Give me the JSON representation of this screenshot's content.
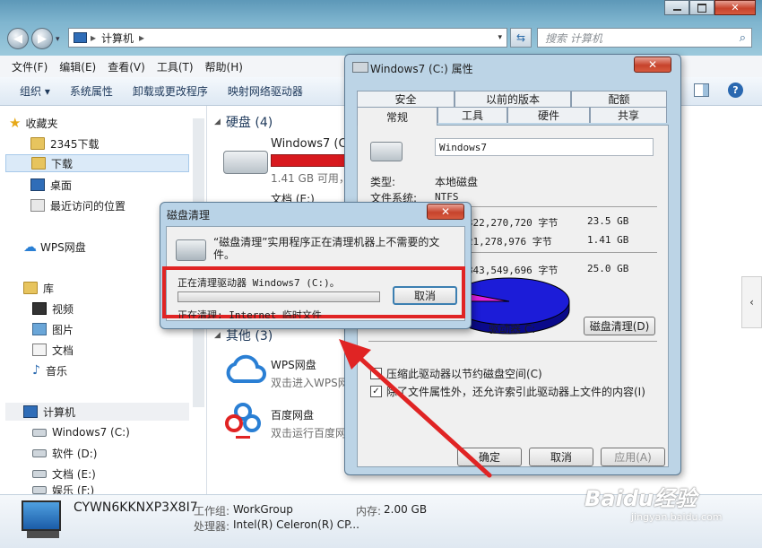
{
  "explorer": {
    "address_path": "计算机",
    "search_placeholder": "搜索 计算机",
    "menu": [
      "文件(F)",
      "编辑(E)",
      "查看(V)",
      "工具(T)",
      "帮助(H)"
    ],
    "commands": [
      "组织 ▾",
      "系统属性",
      "卸载或更改程序",
      "映射网络驱动器"
    ],
    "sidebar": {
      "favorites": "收藏夹",
      "fav_items": [
        "2345下载",
        "下载",
        "桌面",
        "最近访问的位置"
      ],
      "wps": "WPS网盘",
      "libraries": "库",
      "lib_items": [
        "视频",
        "图片",
        "文档",
        "音乐"
      ],
      "computer": "计算机",
      "comp_items": [
        "Windows7 (C:)",
        "软件 (D:)",
        "文档 (E:)",
        "娱乐 (F:)"
      ]
    },
    "content": {
      "hard_disk_header": "硬盘 (4)",
      "drive_c_name": "Windows7 (C:)",
      "drive_c_free": "1.41 GB 可用，",
      "drive_e_name": "文档 (E:)",
      "other_header": "其他 (3)",
      "wps_name": "WPS网盘",
      "wps_desc": "双击进入WPS网盘",
      "baidu_name": "百度网盘",
      "baidu_desc": "双击运行百度网盘"
    },
    "status": {
      "computer_name": "CYWN6KKNXP3X8I7",
      "workgroup_label": "工作组:",
      "workgroup": "WorkGroup",
      "memory_label": "内存:",
      "memory": "2.00 GB",
      "cpu_label": "处理器:",
      "cpu": "Intel(R) Celeron(R) CP..."
    }
  },
  "properties": {
    "title": "Windows7 (C:) 属性",
    "tabs_top": [
      "安全",
      "以前的版本",
      "配额"
    ],
    "tabs_bottom": [
      "常规",
      "工具",
      "硬件",
      "共享"
    ],
    "name_value": "Windows7",
    "type_label": "类型:",
    "type_value": "本地磁盘",
    "fs_label": "文件系统:",
    "fs_value": "NTFS",
    "used_bytes": "25,322,270,720 字节",
    "used_size": "23.5 GB",
    "free_bytes": "1,521,278,976 字节",
    "free_size": "1.41 GB",
    "cap_bytes": "26,843,549,696 字节",
    "cap_size": "25.0 GB",
    "drive_label": "驱动器 C:",
    "cleanup_button": "磁盘清理(D)",
    "compress_label": "压缩此驱动器以节约磁盘空间(C)",
    "index_label": "除了文件属性外，还允许索引此驱动器上文件的内容(I)",
    "ok": "确定",
    "cancel": "取消",
    "apply": "应用(A)",
    "used_color": "#1c1cd8",
    "free_color": "#e020e0"
  },
  "disk_cleanup": {
    "title": "磁盘清理",
    "message": "“磁盘清理”实用程序正在清理机器上不需要的文件。",
    "cleaning_drive": "正在清理驱动器 Windows7 (C:)。",
    "cancel": "取消",
    "cleaning_item": "正在清理: Internet 临时文件",
    "highlight_color": "#e02424"
  },
  "watermark": {
    "brand": "Baidu经验",
    "url": "jingyan.baidu.com"
  }
}
